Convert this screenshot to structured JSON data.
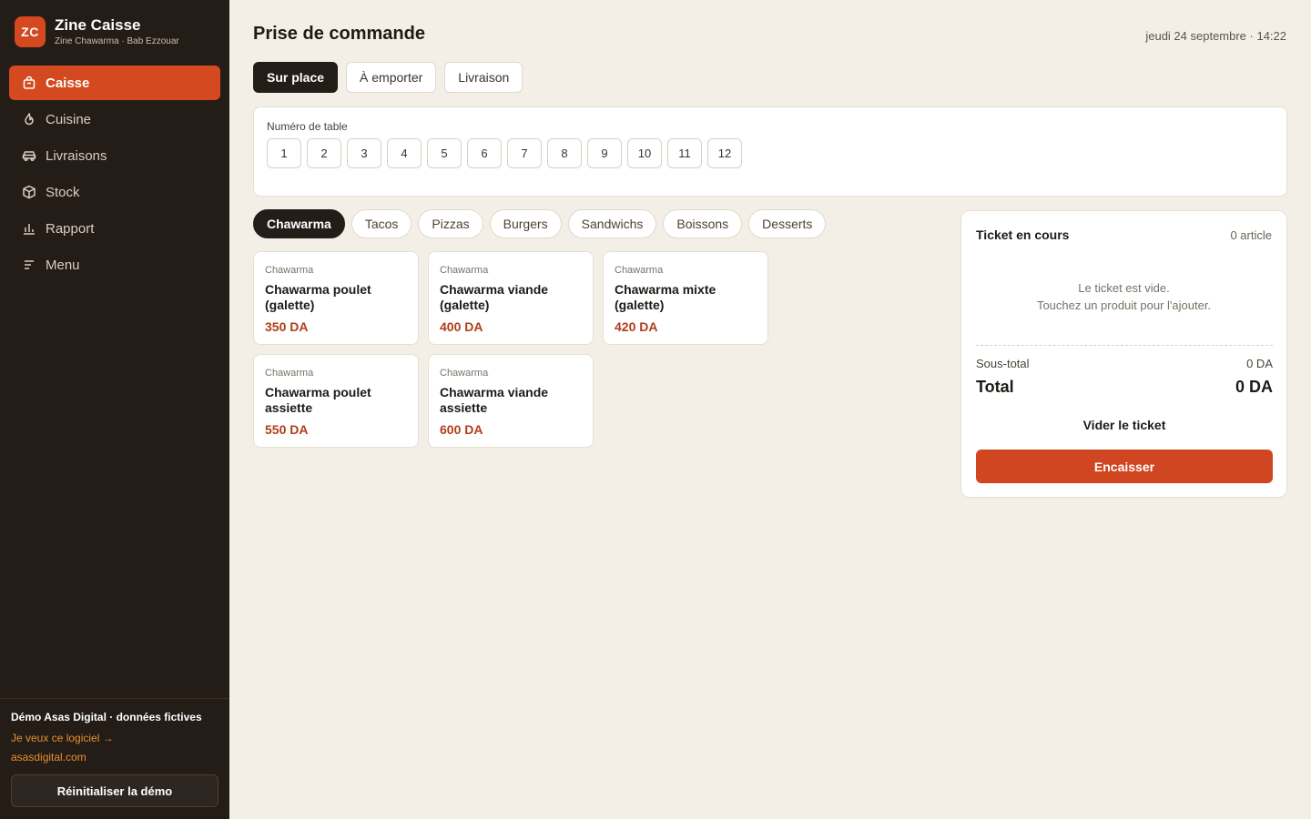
{
  "brand": {
    "logo_text": "ZC",
    "title": "Zine Caisse",
    "subtitle": "Zine Chawarma · Bab Ezzouar",
    "accent_color": "#d4491f"
  },
  "nav": {
    "items": [
      {
        "label": "Caisse",
        "icon": "bag-icon",
        "active": true
      },
      {
        "label": "Cuisine",
        "icon": "flame-icon",
        "active": false
      },
      {
        "label": "Livraisons",
        "icon": "car-icon",
        "active": false
      },
      {
        "label": "Stock",
        "icon": "box-icon",
        "active": false
      },
      {
        "label": "Rapport",
        "icon": "bar-chart-icon",
        "active": false
      },
      {
        "label": "Menu",
        "icon": "list-icon",
        "active": false
      }
    ]
  },
  "footer": {
    "demo_title": "Démo Asas Digital · données fictives",
    "cta_link": "Je veux ce logiciel →",
    "site": "asasdigital.com",
    "reset_label": "Réinitialiser la démo"
  },
  "header": {
    "title": "Prise de commande",
    "datetime": "jeudi 24 septembre · 14:22"
  },
  "order_modes": {
    "items": [
      "Sur place",
      "À emporter",
      "Livraison"
    ],
    "active": "Sur place"
  },
  "table_select": {
    "label": "Numéro de table",
    "numbers": [
      "1",
      "2",
      "3",
      "4",
      "5",
      "6",
      "7",
      "8",
      "9",
      "10",
      "11",
      "12"
    ]
  },
  "categories": {
    "items": [
      "Chawarma",
      "Tacos",
      "Pizzas",
      "Burgers",
      "Sandwichs",
      "Boissons",
      "Desserts"
    ],
    "active": "Chawarma"
  },
  "products": [
    {
      "category": "Chawarma",
      "name": "Chawarma poulet (galette)",
      "price": "350 DA"
    },
    {
      "category": "Chawarma",
      "name": "Chawarma viande (galette)",
      "price": "400 DA"
    },
    {
      "category": "Chawarma",
      "name": "Chawarma mixte (galette)",
      "price": "420 DA"
    },
    {
      "category": "Chawarma",
      "name": "Chawarma poulet assiette",
      "price": "550 DA"
    },
    {
      "category": "Chawarma",
      "name": "Chawarma viande assiette",
      "price": "600 DA"
    }
  ],
  "ticket": {
    "title": "Ticket en cours",
    "count": "0 article",
    "empty_line1": "Le ticket est vide.",
    "empty_line2": "Touchez un produit pour l'ajouter.",
    "subtotal_label": "Sous-total",
    "subtotal_value": "0 DA",
    "total_label": "Total",
    "total_value": "0 DA",
    "clear_label": "Vider le ticket",
    "pay_label": "Encaisser"
  }
}
